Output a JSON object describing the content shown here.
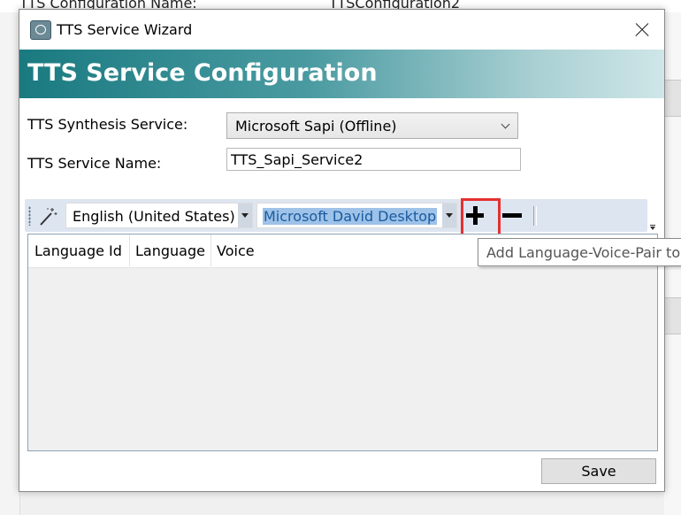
{
  "background": {
    "config_name_label": "TTS Configuration Name:",
    "config_name_value": "TTSConfiguration2"
  },
  "dialog": {
    "title": "TTS Service Wizard",
    "banner_title": "TTS Service Configuration",
    "synthesis_label": "TTS Synthesis Service:",
    "synthesis_value": "Microsoft Sapi (Offline)",
    "service_name_label": "TTS Service Name:",
    "service_name_value": "TTS_Sapi_Service2"
  },
  "toolbar": {
    "language_value": "English (United States)",
    "voice_value": "Microsoft David Desktop",
    "add_tooltip": "Add Language-Voice-Pair to"
  },
  "grid": {
    "columns": [
      "Language Id",
      "Language",
      "Voice"
    ],
    "rows": []
  },
  "footer": {
    "save_label": "Save"
  }
}
